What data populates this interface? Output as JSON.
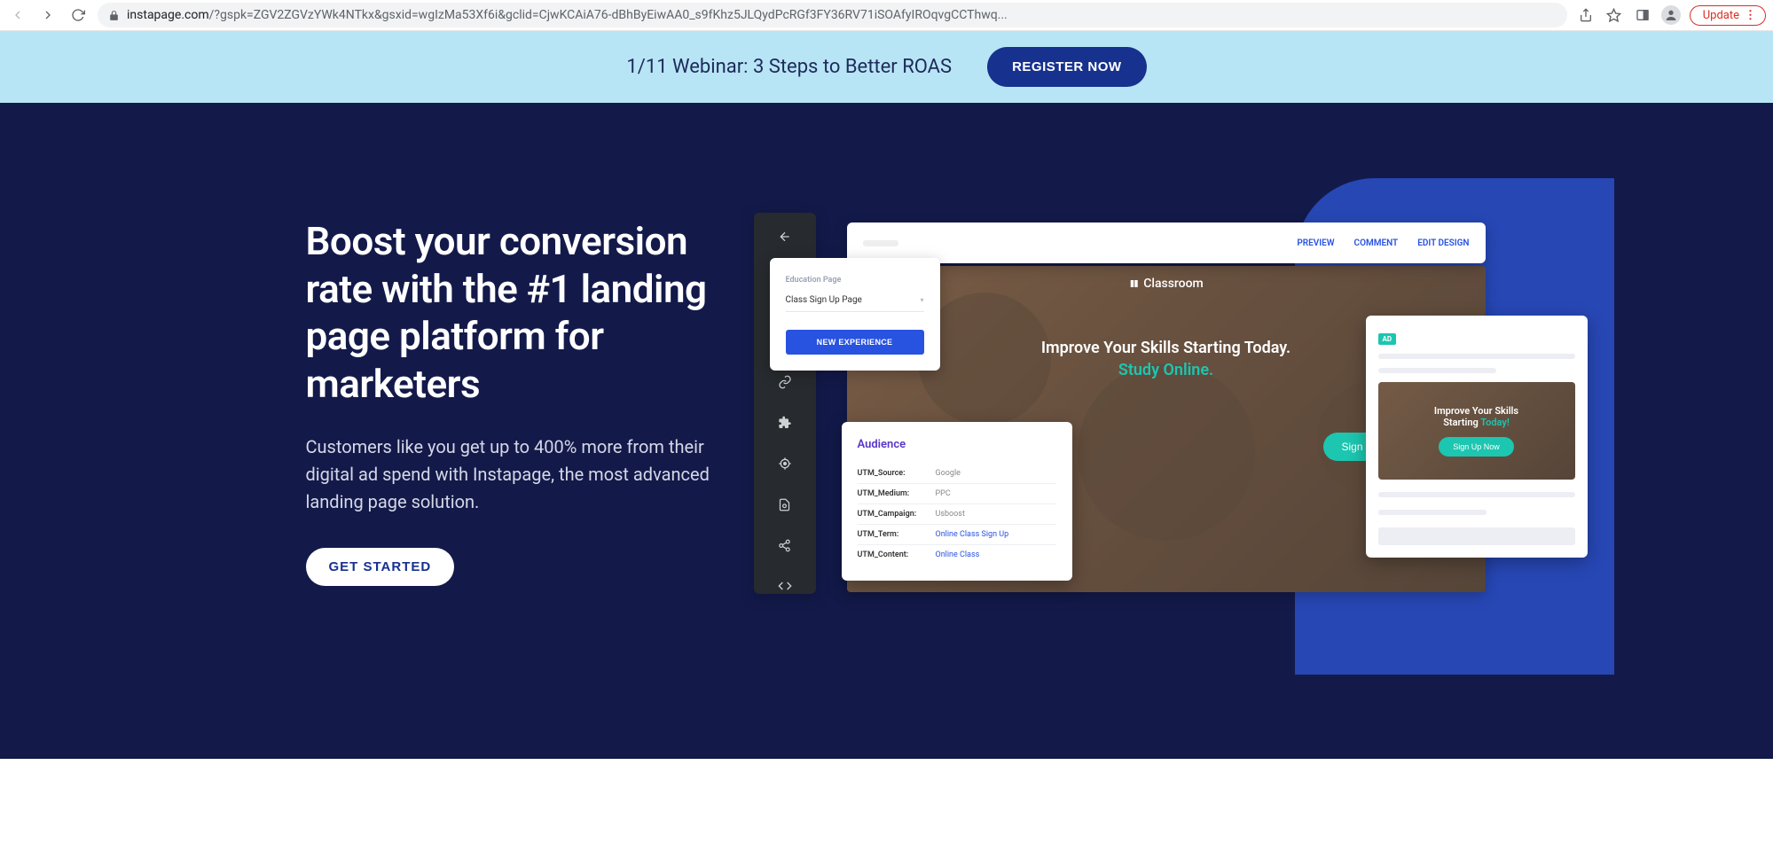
{
  "browser": {
    "domain": "instapage.com",
    "path": "/?gspk=ZGV2ZGVzYWk4NTkx&gsxid=wgIzMa53Xf6i&gclid=CjwKCAiA76-dBhByEiwAA0_s9fKhz5JLQydPcRGf3FY36RV71iSOAfyIROqvgCCThwq...",
    "update_label": "Update"
  },
  "announce": {
    "text": "1/11 Webinar: 3 Steps to Better ROAS",
    "cta": "REGISTER NOW"
  },
  "hero": {
    "title": "Boost your conversion rate with the #1 landing page platform for marketers",
    "subtitle": "Customers like you get up to 400% more from their digital ad spend with Instapage, the most advanced landing page solution.",
    "cta": "GET STARTED"
  },
  "mock": {
    "topbar": {
      "preview": "PREVIEW",
      "comment": "COMMENT",
      "edit": "EDIT DESIGN"
    },
    "edu": {
      "label": "Education Page",
      "selected": "Class Sign Up Page",
      "button": "NEW EXPERIENCE"
    },
    "preview": {
      "brand": "Classroom",
      "line1": "Improve Your Skills Starting Today.",
      "line2": "Study Online.",
      "btn": "Sign Up Now"
    },
    "audience": {
      "title": "Audience",
      "rows": [
        {
          "k": "UTM_Source:",
          "v": "Google",
          "link": false
        },
        {
          "k": "UTM_Medium:",
          "v": "PPC",
          "link": false
        },
        {
          "k": "UTM_Campaign:",
          "v": "Usboost",
          "link": false
        },
        {
          "k": "UTM_Term:",
          "v": "Online Class Sign Up",
          "link": true
        },
        {
          "k": "UTM_Content:",
          "v": "Online Class",
          "link": true
        }
      ]
    },
    "ad": {
      "badge": "AD",
      "line1": "Improve Your Skills",
      "line2_pre": "Starting ",
      "line2_hl": "Today!",
      "btn": "Sign Up Now"
    }
  }
}
